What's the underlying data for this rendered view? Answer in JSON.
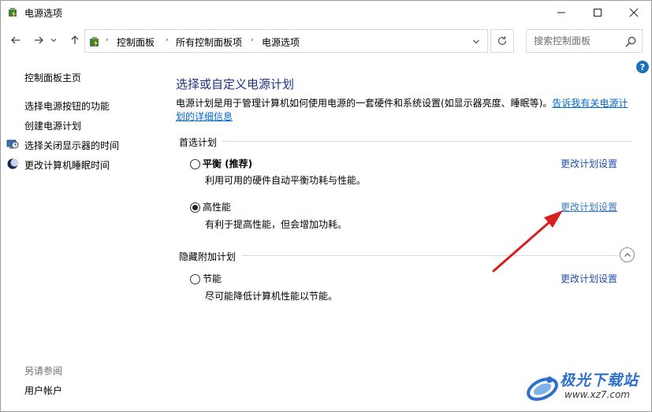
{
  "window": {
    "title": "电源选项",
    "minimize_label": "—",
    "maximize_label": "☐",
    "close_label": "✕"
  },
  "nav": {
    "back": "←",
    "forward": "→",
    "history": "˅",
    "up": "↑",
    "breadcrumbs": [
      "控制面板",
      "所有控制面板项",
      "电源选项"
    ],
    "separator": "›",
    "refresh": "↻"
  },
  "search": {
    "placeholder": "搜索控制面板"
  },
  "help": {
    "label": "?"
  },
  "sidebar": {
    "items": [
      {
        "label": "控制面板主页",
        "icon": ""
      },
      {
        "label": "选择电源按钮的功能",
        "icon": ""
      },
      {
        "label": "创建电源计划",
        "icon": ""
      },
      {
        "label": "选择关闭显示器的时间",
        "icon": "monitor-clock-icon"
      },
      {
        "label": "更改计算机睡眠时间",
        "icon": "moon-icon"
      }
    ],
    "see_also": "另请参阅",
    "user_accounts": "用户帐户"
  },
  "main": {
    "title": "选择或自定义电源计划",
    "description": "电源计划是用于管理计算机如何使用电源的一套硬件和系统设置(如显示器亮度、睡眠等)。",
    "description_link": "告诉我有关电源计划的详细信息",
    "preferred_section": "首选计划",
    "hidden_section": "隐藏附加计划",
    "plans": [
      {
        "name": "平衡 (推荐)",
        "description": "利用可用的硬件自动平衡功耗与性能。",
        "selected": false,
        "link": "更改计划设置"
      },
      {
        "name": "高性能",
        "description": "有利于提高性能，但会增加功耗。",
        "selected": true,
        "link": "更改计划设置"
      }
    ],
    "hidden_plans": [
      {
        "name": "节能",
        "description": "尽可能降低计算机性能以节能。",
        "selected": false,
        "link": "更改计划设置"
      }
    ]
  },
  "watermark": {
    "text": "极光下载站",
    "url": "www.xz7.com"
  },
  "colors": {
    "title_blue": "#1e3287",
    "link_blue": "#1f4fb0",
    "arrow_red": "#d62020"
  }
}
